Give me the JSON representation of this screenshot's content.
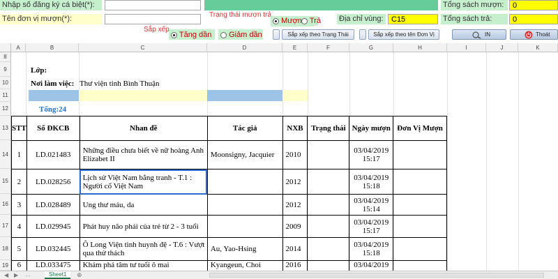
{
  "form": {
    "reg_label": "Nhập số đăng ký cá biệt(*):",
    "unit_label": "Tên đơn vị mượn(*):",
    "status_label": "Trạng thái mượn trả",
    "status_borrow": "Mượn",
    "status_return": "Trả",
    "area_label": "Địa chỉ vùng:",
    "area_value": "C15",
    "sort_label": "Sắp xếp",
    "sort_asc": "Tăng dần",
    "sort_desc": "Giảm dần",
    "total_borrow_label": "Tổng sách mượn:",
    "total_borrow_value": "0",
    "total_return_label": "Tổng sách trả:",
    "total_return_value": "0",
    "btn_sort_status": "Sắp xếp theo Trạng Thái",
    "btn_sort_unit": "Sắp xếp theo tên Đơn Vị",
    "btn_print": "IN",
    "btn_exit": "Thoát"
  },
  "colors": {
    "green_label": "#c6efce",
    "teal_bar": "#66cc99",
    "yellow": "#ffff00",
    "blue_cell": "#9dc3e6",
    "light_yellow_cell": "#ffffcc",
    "total_blue": "#1f6fc5"
  },
  "columns": [
    "A",
    "B",
    "C",
    "D",
    "E",
    "F",
    "G",
    "H",
    "I",
    "J",
    "K"
  ],
  "rows_numbers": [
    "8",
    "9",
    "10",
    "11",
    "12",
    "13",
    "14",
    "15",
    "16",
    "17",
    "18",
    "19"
  ],
  "sheet": {
    "lop_label": "Lớp:",
    "noi_lam_viec_label": "Nơi làm việc:",
    "noi_lam_viec_value": "Thư viện tỉnh Bình Thuận",
    "total": "Tổng:24"
  },
  "table": {
    "headers": [
      "STT",
      "Số ĐKCB",
      "Nhan đề",
      "Tác giả",
      "NXB",
      "Trạng thái",
      "Ngày mượn",
      "Đơn Vị Mượn"
    ],
    "rows": [
      {
        "stt": "1",
        "dkcb": "LD.021483",
        "title": "Những điều chưa biết về nữ hoàng Anh Elizabet II",
        "author": "Moonsigny, Jacquier",
        "nxb": "2010",
        "status": "",
        "date": "03/04/2019 15:17",
        "unit": ""
      },
      {
        "stt": "2",
        "dkcb": "LD.028256",
        "title": "Lịch sử Việt Nam bằng tranh - T.1 : Người cổ Việt Nam",
        "author": "",
        "nxb": "2012",
        "status": "",
        "date": "03/04/2019 15:18",
        "unit": ""
      },
      {
        "stt": "3",
        "dkcb": "LD.028489",
        "title": "Ung thư máu, da",
        "author": "",
        "nxb": "2012",
        "status": "",
        "date": "03/04/2019 15:14",
        "unit": ""
      },
      {
        "stt": "4",
        "dkcb": "LD.029945",
        "title": "Phát huy não phải của trẻ từ 2 - 3 tuổi",
        "author": "",
        "nxb": "2009",
        "status": "",
        "date": "03/04/2019 15:17",
        "unit": ""
      },
      {
        "stt": "5",
        "dkcb": "LD.032445",
        "title": "Ô Long Viện tình huynh đệ - T.6 : Vượt qua thử thách",
        "author": "Au, Yao-Hsing",
        "nxb": "2014",
        "status": "",
        "date": "03/04/2019 15:18",
        "unit": ""
      },
      {
        "stt": "6",
        "dkcb": "LD.033475",
        "title": "Khám phá tâm tư tuổi ô mai",
        "author": "Kyangeun, Choi",
        "nxb": "2016",
        "status": "",
        "date": "03/04/2019",
        "unit": ""
      }
    ]
  },
  "tab": {
    "name": "Sheet1"
  }
}
